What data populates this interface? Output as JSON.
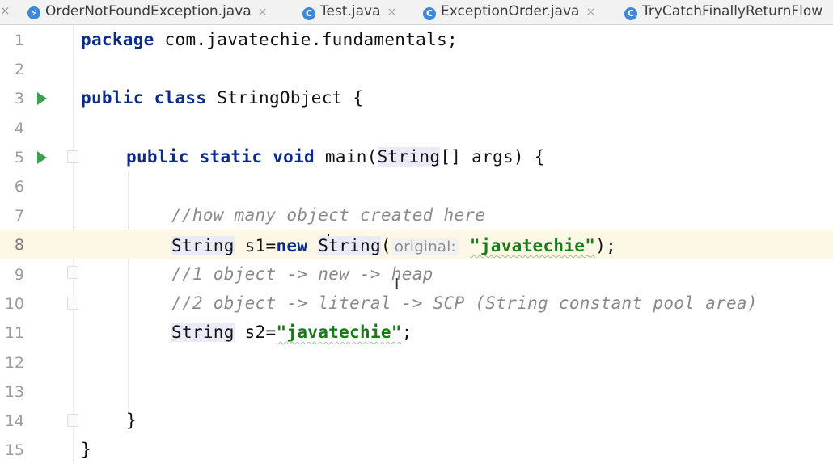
{
  "tabs": [
    {
      "label": "OrderNotFoundException.java",
      "icon": "exception-class-icon",
      "close": "×"
    },
    {
      "label": "Test.java",
      "icon": "class-icon",
      "close": "×"
    },
    {
      "label": "ExceptionOrder.java",
      "icon": "class-icon",
      "close": "×"
    },
    {
      "label": "TryCatchFinallyReturnFlow",
      "icon": "class-icon",
      "close": ""
    }
  ],
  "tab_icon_letters": {
    "class": "C",
    "exception": "⚡"
  },
  "lead_close": "×",
  "line_numbers": [
    "1",
    "2",
    "3",
    "4",
    "5",
    "6",
    "7",
    "8",
    "9",
    "10",
    "11",
    "12",
    "13",
    "14",
    "15"
  ],
  "code": {
    "l1_kw": "package",
    "l1_rest": " com.javatechie.fundamentals;",
    "l3_kw": "public class",
    "l3_rest": " StringObject {",
    "l5_kw": "public static void",
    "l5_main": " main(",
    "l5_type": "String",
    "l5_rest": "[] args) {",
    "l7_comment": "//how many object created here",
    "l8_type": "String",
    "l8_mid": " s1=",
    "l8_new": "new",
    "l8_ctor_a": "S",
    "l8_ctor_b": "tring",
    "l8_paren": "(",
    "l8_hint": "original:",
    "l8_str": "\"javatechie\"",
    "l8_end": ");",
    "l9_comment": "//1 object -> new -> heap",
    "l10_comment": "//2 object -> literal -> SCP (String constant pool area)",
    "l11_type": "String",
    "l11_mid": " s2=",
    "l11_str": "\"javatechie\"",
    "l11_end": ";",
    "l14_brace": "}",
    "l15_brace": "}"
  },
  "current_line": "8",
  "colors": {
    "keyword": "#0b2b8a",
    "string": "#1a7a1a",
    "comment": "#8a8a8a",
    "run": "#3aa24c",
    "current_line_bg": "#fdf8e6"
  }
}
